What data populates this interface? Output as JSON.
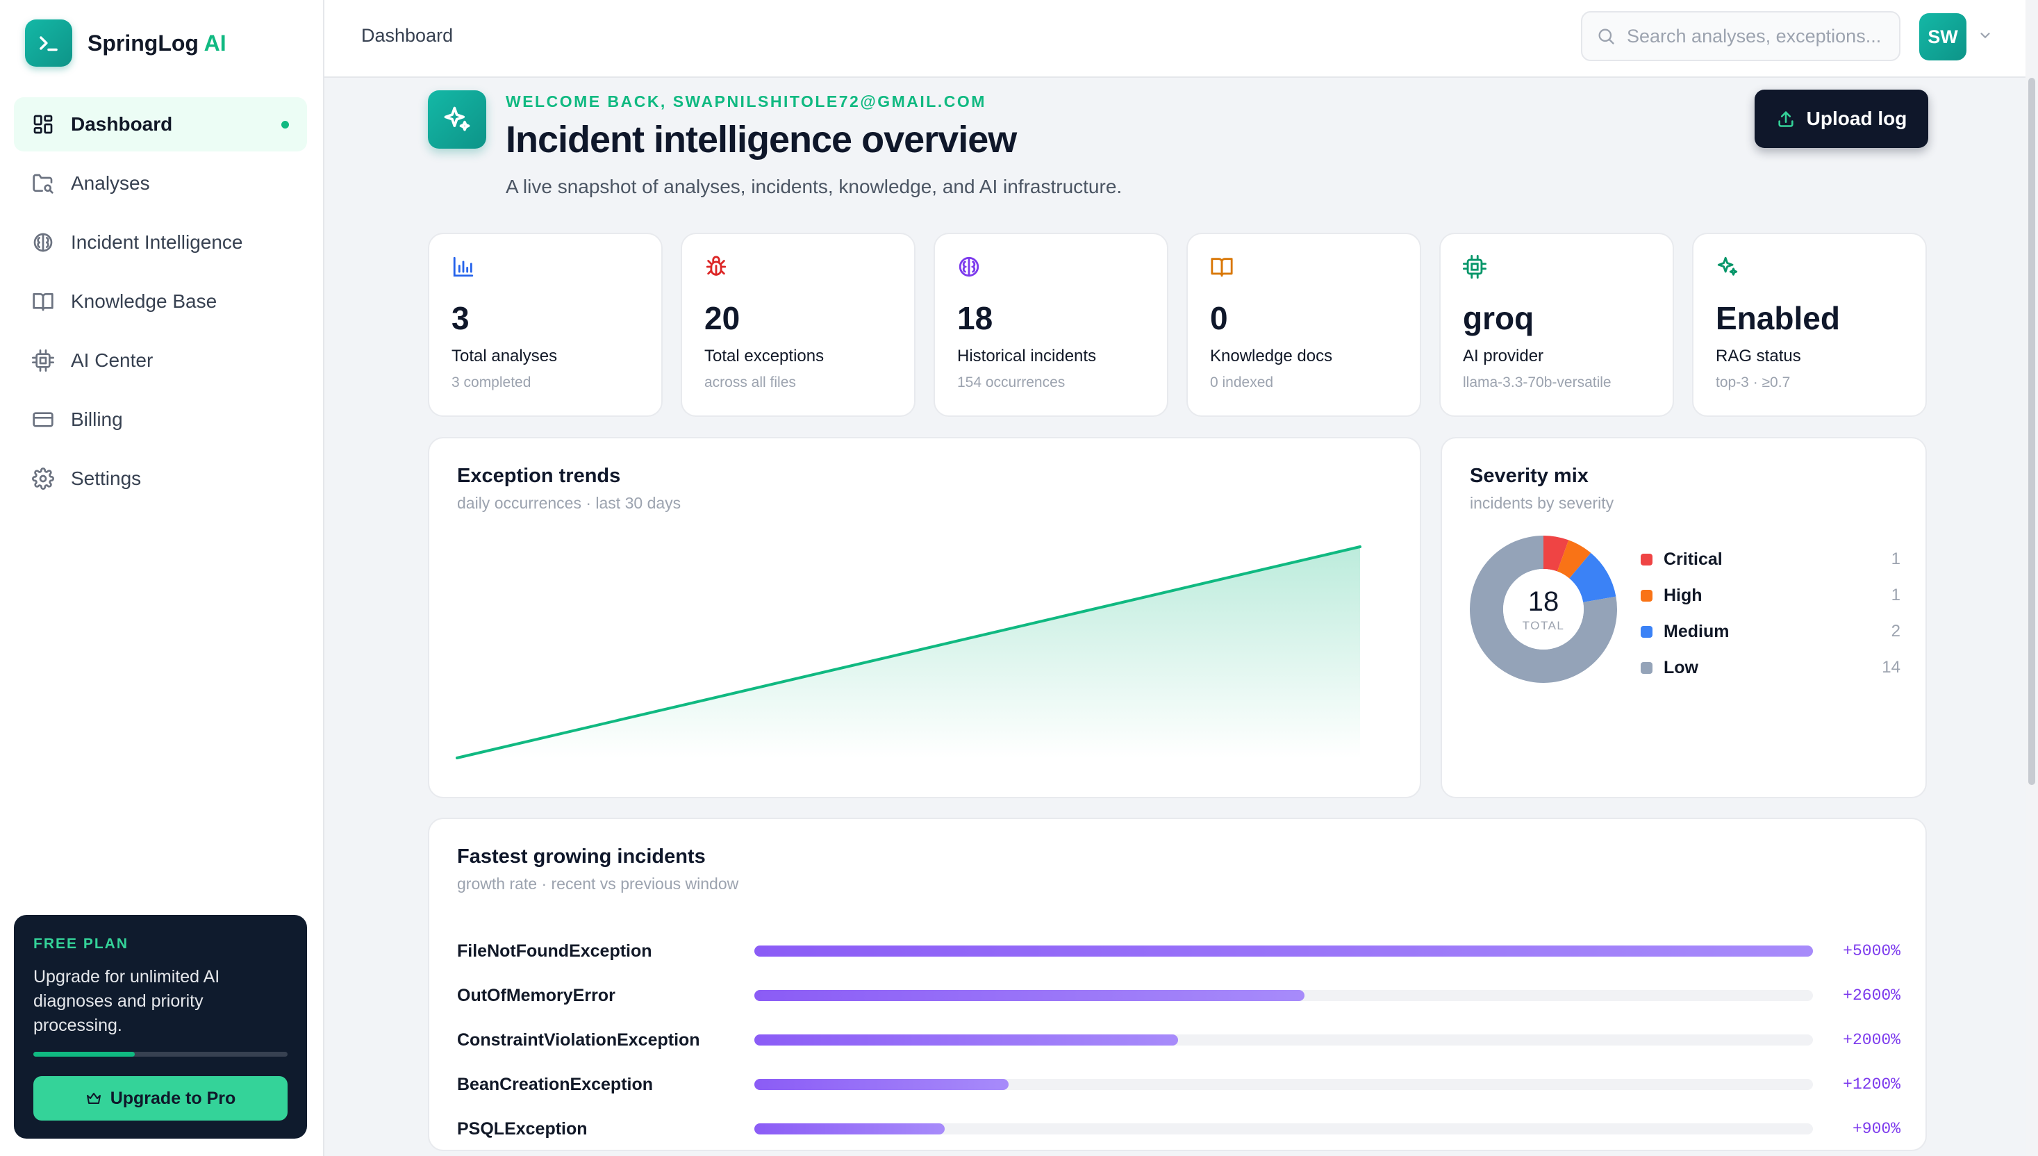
{
  "brand": {
    "name": "SpringLog",
    "accent": "AI"
  },
  "sidebar": {
    "items": [
      {
        "label": "Dashboard",
        "icon": "dashboard-grid-icon",
        "active": true
      },
      {
        "label": "Analyses",
        "icon": "folder-search-icon"
      },
      {
        "label": "Incident Intelligence",
        "icon": "brain-icon"
      },
      {
        "label": "Knowledge Base",
        "icon": "book-open-icon"
      },
      {
        "label": "AI Center",
        "icon": "cpu-icon"
      },
      {
        "label": "Billing",
        "icon": "credit-card-icon"
      },
      {
        "label": "Settings",
        "icon": "gear-icon"
      }
    ],
    "promo": {
      "tag": "FREE PLAN",
      "text": "Upgrade for unlimited AI diagnoses and priority processing.",
      "progress": 0.4,
      "button": "Upgrade to Pro"
    }
  },
  "header": {
    "breadcrumb": "Dashboard",
    "search_placeholder": "Search analyses, exceptions...",
    "avatar": "SW"
  },
  "hero": {
    "welcome": "WELCOME BACK, SWAPNILSHITOLE72@GMAIL.COM",
    "title": "Incident intelligence overview",
    "subtitle": "A live snapshot of analyses, incidents, knowledge, and AI infrastructure.",
    "upload_label": "Upload log"
  },
  "stats": [
    {
      "value": "3",
      "label": "Total analyses",
      "sub": "3 completed",
      "icon": "bar-chart-icon",
      "color": "#2563eb"
    },
    {
      "value": "20",
      "label": "Total exceptions",
      "sub": "across all files",
      "icon": "bug-icon",
      "color": "#dc2626"
    },
    {
      "value": "18",
      "label": "Historical incidents",
      "sub": "154 occurrences",
      "icon": "brain-icon",
      "color": "#7c3aed"
    },
    {
      "value": "0",
      "label": "Knowledge docs",
      "sub": "0 indexed",
      "icon": "book-open-icon",
      "color": "#d97706"
    },
    {
      "value": "groq",
      "label": "AI provider",
      "sub": "llama-3.3-70b-versatile",
      "icon": "cpu-icon",
      "color": "#059669"
    },
    {
      "value": "Enabled",
      "label": "RAG status",
      "sub": "top-3 · ≥0.7",
      "icon": "sparkles-icon",
      "color": "#059669"
    }
  ],
  "trend": {
    "title": "Exception trends",
    "subtitle": "daily occurrences · last 30 days"
  },
  "severity": {
    "title": "Severity mix",
    "subtitle": "incidents by severity",
    "total": "18",
    "total_label": "TOTAL",
    "items": [
      {
        "name": "Critical",
        "value": 1,
        "color": "#ef4444"
      },
      {
        "name": "High",
        "value": 1,
        "color": "#f97316"
      },
      {
        "name": "Medium",
        "value": 2,
        "color": "#3b82f6"
      },
      {
        "name": "Low",
        "value": 14,
        "color": "#94a3b8"
      }
    ]
  },
  "growth": {
    "title": "Fastest growing incidents",
    "subtitle": "growth rate · recent vs previous window",
    "rows": [
      {
        "name": "FileNotFoundException",
        "pct": "+5000%",
        "value": 5000
      },
      {
        "name": "OutOfMemoryError",
        "pct": "+2600%",
        "value": 2600
      },
      {
        "name": "ConstraintViolationException",
        "pct": "+2000%",
        "value": 2000
      },
      {
        "name": "BeanCreationException",
        "pct": "+1200%",
        "value": 1200
      },
      {
        "name": "PSQLException",
        "pct": "+900%",
        "value": 900
      }
    ]
  }
}
